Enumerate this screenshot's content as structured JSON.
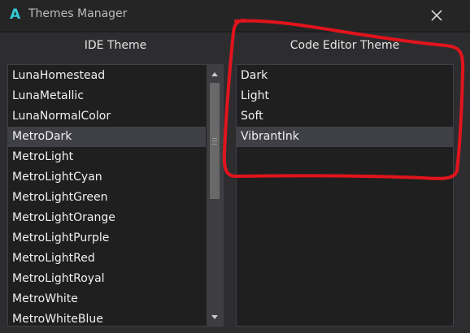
{
  "window": {
    "title": "Themes Manager",
    "logo_letter": "A",
    "close_icon": "close-icon"
  },
  "ide_theme": {
    "header": "IDE Theme",
    "items": [
      "LunaHomestead",
      "LunaMetallic",
      "LunaNormalColor",
      "MetroDark",
      "MetroLight",
      "MetroLightCyan",
      "MetroLightGreen",
      "MetroLightOrange",
      "MetroLightPurple",
      "MetroLightRed",
      "MetroLightRoyal",
      "MetroWhite",
      "MetroWhiteBlue"
    ],
    "selected": "MetroDark"
  },
  "code_editor_theme": {
    "header": "Code Editor Theme",
    "items": [
      "Dark",
      "Light",
      "Soft",
      "VibrantInk"
    ],
    "selected": "VibrantInk"
  },
  "colors": {
    "background": "#2d2d30",
    "list_background": "#1f1f1f",
    "selected_row": "#3f3f46",
    "logo_accent": "#36c8d6",
    "annotation_stroke": "#e0141c"
  }
}
